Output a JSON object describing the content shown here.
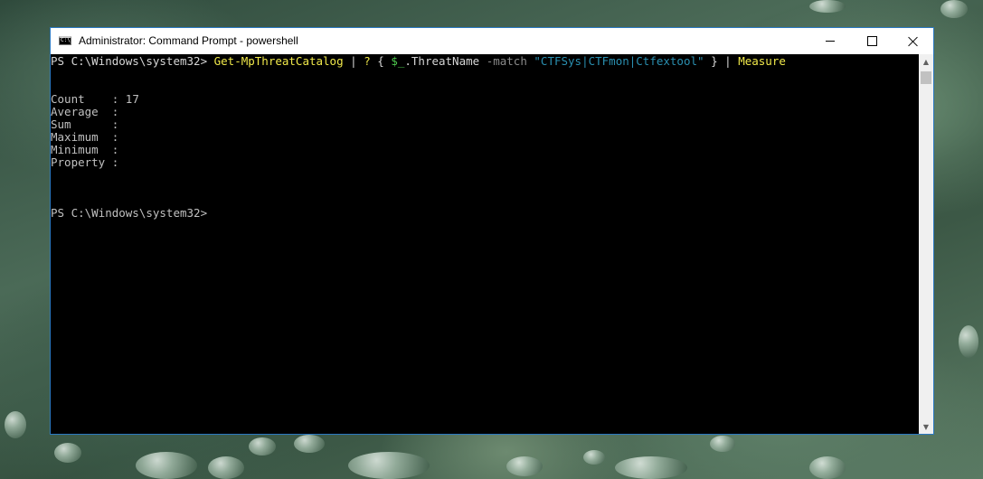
{
  "window": {
    "title": "Administrator: Command Prompt - powershell",
    "icon_label": "C:\\",
    "buttons": [
      "minimize",
      "maximize",
      "close"
    ]
  },
  "console": {
    "command_line": {
      "prompt": "PS C:\\Windows\\system32> ",
      "cmdlet": "Get-MpThreatCatalog",
      "pipe1": " | ",
      "where_alias": "?",
      "brace_open": " { ",
      "var_dollar": "$_",
      "property": ".ThreatName",
      "operator": " -match ",
      "pattern": "\"CTFSys|CTFmon|Ctfextool\"",
      "brace_close": " } ",
      "pipe2": "| ",
      "measure": "Measure"
    },
    "output": [
      {
        "label": "Count    : ",
        "value": "17"
      },
      {
        "label": "Average  : ",
        "value": ""
      },
      {
        "label": "Sum      : ",
        "value": ""
      },
      {
        "label": "Maximum  : ",
        "value": ""
      },
      {
        "label": "Minimum  : ",
        "value": ""
      },
      {
        "label": "Property : ",
        "value": ""
      }
    ],
    "final_prompt": "PS C:\\Windows\\system32>"
  },
  "colors": {
    "console_bg": "#000000",
    "default_text": "#c0c0c0",
    "cmdlet": "#f0e84a",
    "operator": "#8a8a8a",
    "string": "#2a8fb0",
    "window_border": "#2b79c2"
  },
  "icons": {
    "window_icon": "command-prompt-icon",
    "minimize": "minimize-icon",
    "maximize": "maximize-icon",
    "close": "close-icon",
    "scroll_up": "chevron-up-icon",
    "scroll_down": "chevron-down-icon"
  }
}
